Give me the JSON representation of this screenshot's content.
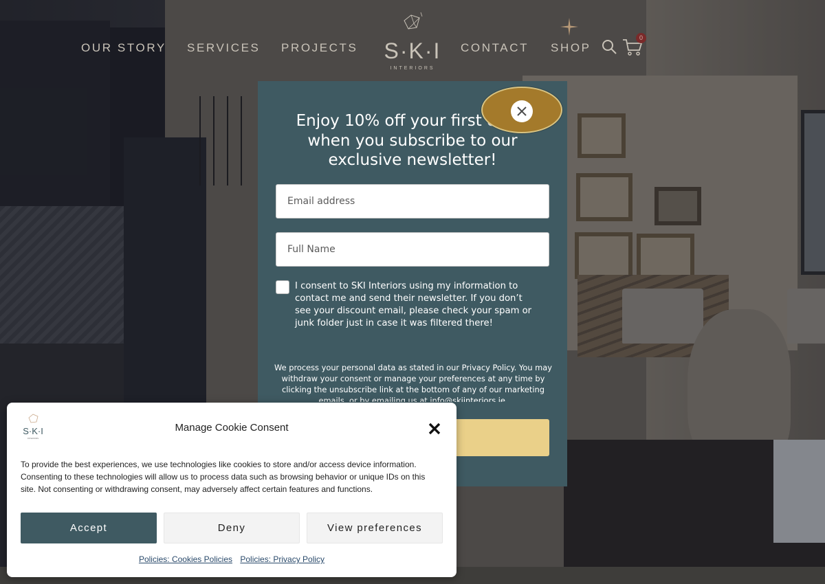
{
  "nav": {
    "items": [
      "OUR STORY",
      "SERVICES",
      "PROJECTS",
      "CONTACT",
      "SHOP"
    ],
    "logo": {
      "main": "S·K·I",
      "sub": "INTERIORS"
    },
    "cart_count": "0",
    "icons": [
      "sparkle-icon",
      "search-icon",
      "cart-icon"
    ]
  },
  "newsletter": {
    "heading": "Enjoy 10% off your first order when you subscribe to our exclusive newsletter!",
    "email_placeholder": "Email address",
    "name_placeholder": "Full Name",
    "consent_text": "I consent to SKI Interiors using my information to contact me and send their newsletter. If you don’t see your discount email, please check your spam or junk folder just in case it was filtered there!",
    "privacy_text": "We process your personal data as stated in our Privacy Policy. You may withdraw your consent or manage your preferences at any time by clicking the unsubscribe link at the bottom of any of our marketing emails, or by emailing us at info@skiinteriors.ie.",
    "submit_label": "",
    "accent_color": "#ead089",
    "panel_color": "#3f5a62"
  },
  "cookie": {
    "title": "Manage Cookie Consent",
    "text": "To provide the best experiences, we use technologies like cookies to store and/or access device information. Consenting to these technologies will allow us to process data such as browsing behavior or unique IDs on this site. Not consenting or withdrawing consent, may adversely affect certain features and functions.",
    "accept_label": "Accept",
    "deny_label": "Deny",
    "preferences_label": "View preferences",
    "links": [
      "Policies: Cookies Policies",
      "Policies: Privacy Policy"
    ],
    "accept_color": "#3f5a62"
  }
}
